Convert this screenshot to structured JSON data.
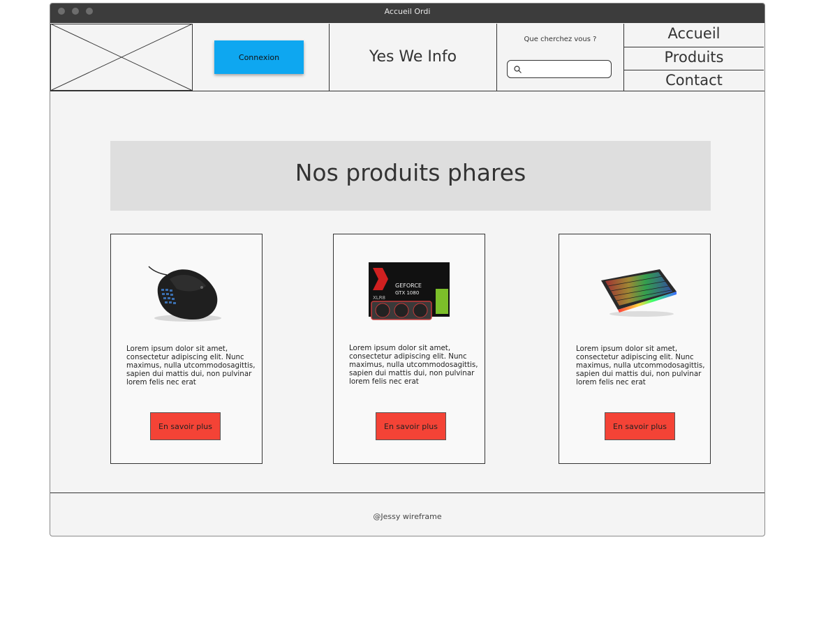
{
  "window": {
    "title": "Accueil Ordi"
  },
  "header": {
    "connexion_label": "Connexion",
    "brand": "Yes We Info",
    "search": {
      "label": "Que cherchez vous ?",
      "value": "",
      "placeholder": ""
    },
    "nav": [
      {
        "label": "Accueil"
      },
      {
        "label": "Produits"
      },
      {
        "label": "Contact"
      }
    ]
  },
  "main": {
    "banner_title": "Nos produits phares",
    "products": [
      {
        "image_icon": "gaming-mouse-icon",
        "description": "Lorem ipsum dolor sit amet, consectetur adipiscing elit. Nunc maximus, nulla utcommodosagittis, sapien dui mattis dui, non pulvinar lorem felis nec erat",
        "button_label": "En savoir plus"
      },
      {
        "image_icon": "graphics-card-box-icon",
        "image_text_1": "GEFORCE",
        "image_text_2": "GTX 1080",
        "image_text_3": "XLR8",
        "description": "Lorem ipsum dolor sit amet, consectetur adipiscing elit. Nunc maximus, nulla utcommodosagittis, sapien dui mattis dui, non pulvinar lorem felis nec erat",
        "button_label": "En savoir plus"
      },
      {
        "image_icon": "rgb-keyboard-icon",
        "description": "Lorem ipsum dolor sit amet, consectetur adipiscing elit. Nunc maximus, nulla utcommodosagittis, sapien dui mattis dui, non pulvinar lorem felis nec erat",
        "button_label": "En savoir plus"
      }
    ]
  },
  "footer": {
    "text": "@Jessy wireframe"
  },
  "colors": {
    "connexion_button": "#0ea7f0",
    "action_button": "#f44336",
    "titlebar": "#3c3c3c",
    "banner": "#dedede"
  }
}
